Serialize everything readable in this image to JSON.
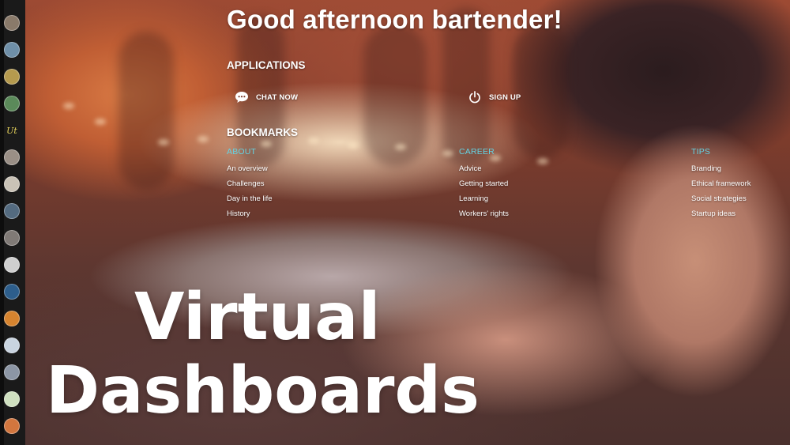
{
  "greeting": "Good afternoon bartender!",
  "applications": {
    "heading": "APPLICATIONS",
    "items": [
      {
        "label": "CHAT NOW",
        "icon": "chat-icon"
      },
      {
        "label": "SIGN UP",
        "icon": "power-icon"
      }
    ]
  },
  "bookmarks": {
    "heading": "BOOKMARKS",
    "columns": [
      {
        "heading": "ABOUT",
        "links": [
          "An overview",
          "Challenges",
          "Day in the life",
          "History"
        ]
      },
      {
        "heading": "CAREER",
        "links": [
          "Advice",
          "Getting started",
          "Learning",
          "Workers' rights"
        ]
      },
      {
        "heading": "TIPS",
        "links": [
          "Branding",
          "Ethical framework",
          "Social strategies",
          "Startup ideas"
        ]
      }
    ]
  },
  "overlay": {
    "line1": "Virtual",
    "line2": "Dashboards"
  },
  "dock": {
    "items": [
      {
        "icon": "app-avatar-icon",
        "color": "#8a7a6a"
      },
      {
        "icon": "app-globe-icon",
        "color": "#6f8fa8"
      },
      {
        "icon": "app-coin-icon",
        "color": "#b59a4e"
      },
      {
        "icon": "app-landscape-icon",
        "color": "#5b8a5a"
      },
      {
        "icon": "app-ut-logo-icon",
        "color": "#1a1a1a",
        "text": "Ut"
      },
      {
        "icon": "app-portrait-icon",
        "color": "#9a8f86"
      },
      {
        "icon": "app-profile-icon",
        "color": "#c9c2b6"
      },
      {
        "icon": "app-skyline-icon",
        "color": "#546b80"
      },
      {
        "icon": "app-gear-icon",
        "color": "#807a76"
      },
      {
        "icon": "app-pen-icon",
        "color": "#cfcfcf"
      },
      {
        "icon": "app-ring-icon",
        "color": "#2d5e8c"
      },
      {
        "icon": "app-grid-icon",
        "color": "#d7842f"
      },
      {
        "icon": "app-sphere-icon",
        "color": "#c9d4e0"
      },
      {
        "icon": "app-cube-icon",
        "color": "#8c96a5"
      },
      {
        "icon": "app-plant-icon",
        "color": "#cfe0c0"
      },
      {
        "icon": "app-sunset-icon",
        "color": "#d2763e"
      },
      {
        "icon": "app-fruit-icon",
        "color": "#e6a24a"
      }
    ]
  },
  "colors": {
    "accent": "#64d3e3",
    "dock": "#1a1a1a"
  }
}
